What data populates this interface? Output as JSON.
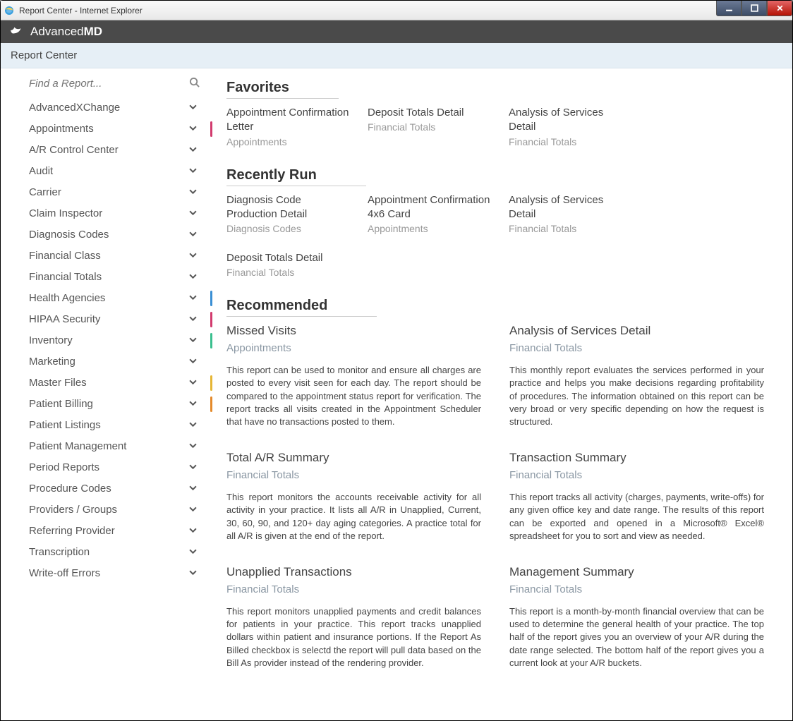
{
  "window": {
    "title": "Report Center - Internet Explorer"
  },
  "brand": {
    "name_light": "Advanced",
    "name_bold": "MD"
  },
  "subheader": {
    "title": "Report Center"
  },
  "search": {
    "placeholder": "Find a Report..."
  },
  "sidebar": {
    "items": [
      {
        "label": "AdvancedXChange",
        "marker": ""
      },
      {
        "label": "Appointments",
        "marker": "#d23b6e"
      },
      {
        "label": "A/R Control Center",
        "marker": ""
      },
      {
        "label": "Audit",
        "marker": ""
      },
      {
        "label": "Carrier",
        "marker": ""
      },
      {
        "label": "Claim Inspector",
        "marker": ""
      },
      {
        "label": "Diagnosis Codes",
        "marker": ""
      },
      {
        "label": "Financial Class",
        "marker": ""
      },
      {
        "label": "Financial Totals",
        "marker": ""
      },
      {
        "label": "Health Agencies",
        "marker": "#3a8fd4"
      },
      {
        "label": "HIPAA Security",
        "marker": "#d23b6e"
      },
      {
        "label": "Inventory",
        "marker": "#3bbf8f"
      },
      {
        "label": "Marketing",
        "marker": ""
      },
      {
        "label": "Master Files",
        "marker": "#e6b635"
      },
      {
        "label": "Patient Billing",
        "marker": "#e48a2b"
      },
      {
        "label": "Patient Listings",
        "marker": ""
      },
      {
        "label": "Patient Management",
        "marker": ""
      },
      {
        "label": "Period Reports",
        "marker": ""
      },
      {
        "label": "Procedure Codes",
        "marker": ""
      },
      {
        "label": "Providers / Groups",
        "marker": ""
      },
      {
        "label": "Referring Provider",
        "marker": ""
      },
      {
        "label": "Transcription",
        "marker": ""
      },
      {
        "label": "Write-off Errors",
        "marker": ""
      }
    ]
  },
  "favorites": {
    "title": "Favorites",
    "items": [
      {
        "title": "Appointment Confirmation Letter",
        "cat": "Appointments"
      },
      {
        "title": "Deposit Totals Detail",
        "cat": "Financial Totals"
      },
      {
        "title": "Analysis of Services Detail",
        "cat": "Financial Totals"
      }
    ]
  },
  "recent": {
    "title": "Recently Run",
    "items": [
      {
        "title": "Diagnosis Code Production Detail",
        "cat": "Diagnosis Codes"
      },
      {
        "title": "Appointment Confirmation 4x6 Card",
        "cat": "Appointments"
      },
      {
        "title": "Analysis of Services Detail",
        "cat": "Financial Totals"
      },
      {
        "title": "Deposit Totals Detail",
        "cat": "Financial Totals"
      }
    ]
  },
  "recommended": {
    "title": "Recommended",
    "items": [
      {
        "title": "Missed Visits",
        "cat": "Appointments",
        "desc": "This report can be used to monitor and ensure all charges are posted to every visit seen for each day. The report should be compared to the appointment status report for verification. The report tracks all visits created in the Appointment Scheduler that have no transactions posted to them."
      },
      {
        "title": "Analysis of Services Detail",
        "cat": "Financial Totals",
        "desc": "This monthly report evaluates the services performed in your practice and helps you make decisions regarding profitability of procedures. The information obtained on this report can be very broad or very specific depending on how the request is structured."
      },
      {
        "title": "Total A/R Summary",
        "cat": "Financial Totals",
        "desc": "This report monitors the accounts receivable activity for all activity in your practice. It lists all A/R in Unapplied, Current, 30, 60, 90, and 120+ day aging categories. A practice total for all A/R is given at the end of the report."
      },
      {
        "title": "Transaction Summary",
        "cat": "Financial Totals",
        "desc": "This report tracks all activity (charges, payments, write-offs) for any given office key and date range. The results of this report can be exported and opened in a Microsoft® Excel® spreadsheet for you to sort and view as needed."
      },
      {
        "title": "Unapplied Transactions",
        "cat": "Financial Totals",
        "desc": "This report monitors unapplied payments and credit balances for patients in your practice. This report tracks unapplied dollars within patient and insurance portions. If the Report As Billed checkbox is selectd the report will pull data based on the Bill As provider instead of the rendering provider."
      },
      {
        "title": "Management Summary",
        "cat": "Financial Totals",
        "desc": "This report is a month-by-month financial overview that can be used to determine the general health of your practice. The top half of the report gives you an overview of your A/R during the date range selected. The bottom half of the report gives you a current look at your A/R buckets."
      }
    ]
  }
}
